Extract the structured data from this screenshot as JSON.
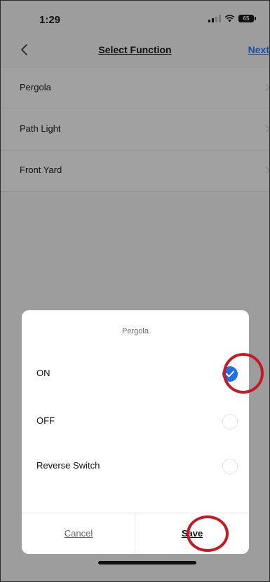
{
  "status_bar": {
    "time": "1:29",
    "battery": "65"
  },
  "nav": {
    "title": "Select Function",
    "next_label": "Next"
  },
  "list": {
    "items": [
      {
        "label": "Pergola"
      },
      {
        "label": "Path Light"
      },
      {
        "label": "Front Yard"
      }
    ]
  },
  "sheet": {
    "title": "Pergola",
    "options": [
      {
        "label": "ON",
        "selected": true
      },
      {
        "label": "OFF",
        "selected": false
      },
      {
        "label": "Reverse Switch",
        "selected": false
      }
    ],
    "cancel_label": "Cancel",
    "save_label": "Save"
  },
  "colors": {
    "accent": "#1f6fe6",
    "highlight": "#c61a22",
    "link": "#1f4fa3",
    "overlay": "#9d9d9d"
  }
}
